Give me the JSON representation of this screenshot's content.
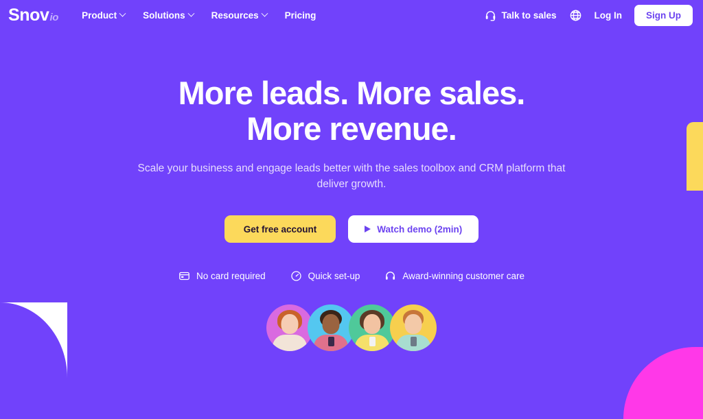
{
  "theme": {
    "background": "#7142fb",
    "accent_yellow": "#fcd95b",
    "accent_pink": "#ff38e8",
    "accent_white": "#ffffff",
    "text_on_white": "#6c43f0"
  },
  "header": {
    "logo": {
      "name": "Snov",
      "suffix": "io"
    },
    "nav": [
      {
        "label": "Product",
        "has_dropdown": true,
        "icon": "chevron-down-icon"
      },
      {
        "label": "Solutions",
        "has_dropdown": true,
        "icon": "chevron-down-icon"
      },
      {
        "label": "Resources",
        "has_dropdown": true,
        "icon": "chevron-down-icon"
      },
      {
        "label": "Pricing",
        "has_dropdown": false
      }
    ],
    "talk_to_sales": {
      "label": "Talk to sales",
      "icon": "headset-icon"
    },
    "language": {
      "icon": "globe-icon"
    },
    "login_label": "Log In",
    "signup_label": "Sign Up"
  },
  "hero": {
    "title_line1": "More leads. More sales.",
    "title_line2": "More revenue.",
    "subtitle": "Scale your business and engage leads better with the sales toolbox and CRM platform that deliver growth.",
    "cta_primary": "Get free account",
    "cta_secondary": "Watch demo (2min)",
    "cta_secondary_icon": "play-icon",
    "features": [
      {
        "label": "No card required",
        "icon": "credit-card-icon"
      },
      {
        "label": "Quick set-up",
        "icon": "speedometer-icon"
      },
      {
        "label": "Award-winning customer care",
        "icon": "headset-icon"
      }
    ],
    "avatars": [
      {
        "name": "avatar-woman-red-hair",
        "bg": "#d96ae0",
        "hair": "#c9622b",
        "skin": "#f6cdb4",
        "clothes": "#f2e4d8",
        "phone": null
      },
      {
        "name": "avatar-woman-afro",
        "bg": "#54c7f0",
        "hair": "#3a2418",
        "skin": "#9a6340",
        "clothes": "#e0718c",
        "phone": "#3a2a4a"
      },
      {
        "name": "avatar-woman-brunette",
        "bg": "#4fc99a",
        "hair": "#5a3a26",
        "skin": "#f2c3a2",
        "clothes": "#f5e06a",
        "phone": "#f2f2f2"
      },
      {
        "name": "avatar-man-glasses",
        "bg": "#f7cf4e",
        "hair": "#c7763a",
        "skin": "#f3c9a8",
        "clothes": "#a8ddd0",
        "phone": "#6d7a86"
      }
    ]
  },
  "decorations": [
    {
      "name": "yellow-bar-right",
      "color": "#fcd95b"
    },
    {
      "name": "white-quarter-left",
      "color": "#ffffff"
    },
    {
      "name": "pink-quarter-bottom-right",
      "color": "#ff38e8"
    }
  ]
}
